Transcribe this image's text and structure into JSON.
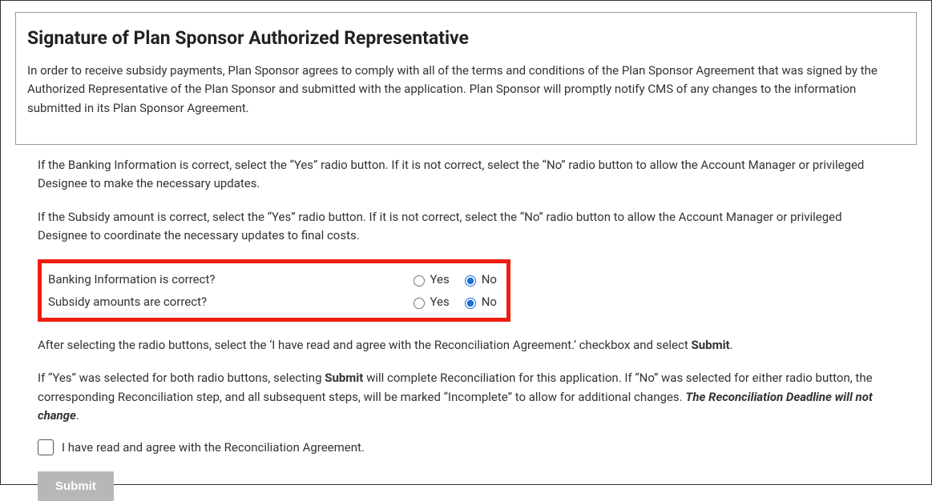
{
  "panel": {
    "heading": "Signature of Plan Sponsor Authorized Representative",
    "body": "In order to receive subsidy payments, Plan Sponsor agrees to comply with all of the terms and conditions of the Plan Sponsor Agreement that was signed by the Authorized Representative of the Plan Sponsor and submitted with the application. Plan Sponsor will promptly notify CMS of any changes to the information submitted in its Plan Sponsor Agreement."
  },
  "instructions": {
    "banking": "If the Banking Information is correct, select the “Yes” radio button. If it is not correct, select the “No” radio button to allow the Account Manager or privileged Designee to make the necessary updates.",
    "subsidy": "If the Subsidy amount is correct, select the “Yes” radio button. If it is not correct, select the “No” radio button to allow the Account Manager or privileged Designee to coordinate the necessary updates to final costs.",
    "after_pre": "After selecting the radio buttons, select the ‘I have read and agree with the Reconciliation Agreement.’ checkbox and select ",
    "after_bold": "Submit",
    "after_post": ".",
    "yesno_pre": "If “Yes” was selected for both radio buttons, selecting ",
    "yesno_bold1": "Submit",
    "yesno_mid": " will complete Reconciliation for this application. If “No” was selected for either radio button, the corresponding Reconciliation step, and all subsequent steps, will be marked “Incomplete” to allow for additional changes. ",
    "yesno_bolditalic": "The Reconciliation Deadline will not change",
    "yesno_post": "."
  },
  "questions": {
    "q1_label": "Banking Information is correct?",
    "q2_label": "Subsidy amounts are correct?",
    "yes": "Yes",
    "no": "No",
    "q1_selected": "No",
    "q2_selected": "No"
  },
  "agreement_checkbox": {
    "label": "I have read and agree with the Reconciliation Agreement.",
    "checked": false
  },
  "submit_label": "Submit"
}
